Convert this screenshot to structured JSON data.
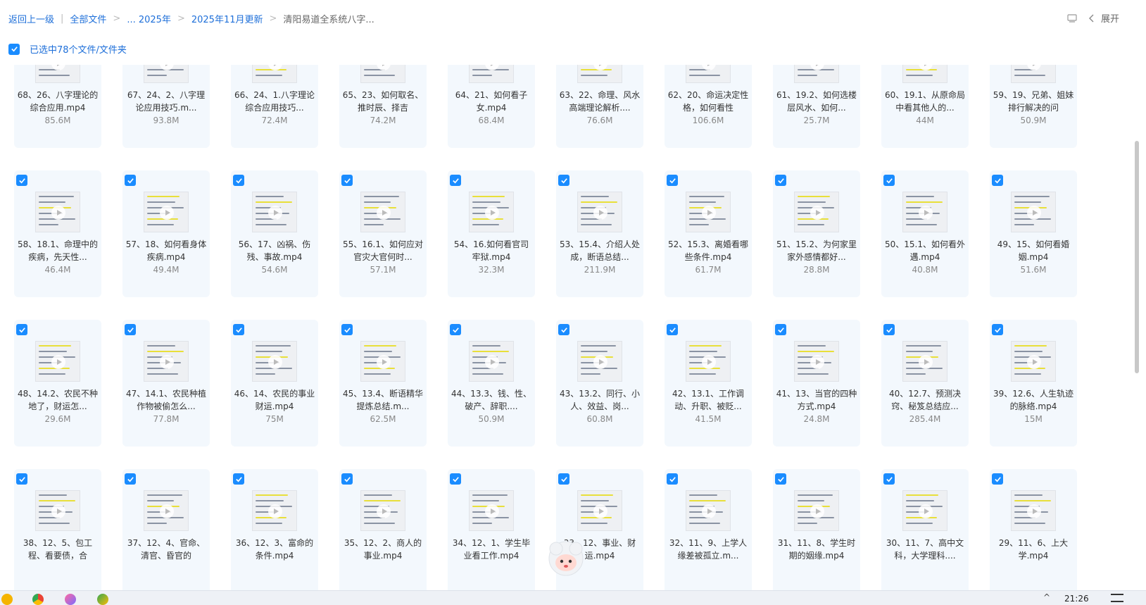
{
  "breadcrumb": {
    "back": "返回上一级",
    "items": [
      "全部文件",
      "... 2025年",
      "2025年11月更新",
      "清阳易道全系统八字..."
    ]
  },
  "toolbar": {
    "expand": "展开"
  },
  "selection": {
    "text": "已选中78个文件/文件夹"
  },
  "files": [
    {
      "name": "68、26、八字理论的综合应用.mp4",
      "size": "85.6M"
    },
    {
      "name": "67、24、2、八字理论应用技巧.m...",
      "size": "93.8M"
    },
    {
      "name": "66、24、1.八字理论综合应用技巧...",
      "size": "72.4M"
    },
    {
      "name": "65、23、如何取名、推时辰、择吉",
      "size": "74.2M"
    },
    {
      "name": "64、21、如何看子女.mp4",
      "size": "68.4M"
    },
    {
      "name": "63、22、命理、风水高端理论解析....",
      "size": "76.6M"
    },
    {
      "name": "62、20、命运决定性格，如何看性",
      "size": "106.6M"
    },
    {
      "name": "61、19.2、如何选楼层风水、如何...",
      "size": "25.7M"
    },
    {
      "name": "60、19.1、从原命局中看其他人的...",
      "size": "44M"
    },
    {
      "name": "59、19、兄弟、姐妹排行解决的问",
      "size": "50.9M"
    },
    {
      "name": "58、18.1、命理中的疾病，先天性...",
      "size": "46.4M"
    },
    {
      "name": "57、18、如何看身体疾病.mp4",
      "size": "49.4M"
    },
    {
      "name": "56、17、凶祸、伤残、事故.mp4",
      "size": "54.6M"
    },
    {
      "name": "55、16.1、如何应对官灾大官何时...",
      "size": "57.1M"
    },
    {
      "name": "54、16.如何看官司牢狱.mp4",
      "size": "32.3M"
    },
    {
      "name": "53、15.4、介绍人处成，断语总结...",
      "size": "211.9M"
    },
    {
      "name": "52、15.3、离婚看哪些条件.mp4",
      "size": "61.7M"
    },
    {
      "name": "51、15.2、为何家里家外感情都好...",
      "size": "28.8M"
    },
    {
      "name": "50、15.1、如何看外遇.mp4",
      "size": "40.8M"
    },
    {
      "name": "49、15、如何看婚姻.mp4",
      "size": "51.6M"
    },
    {
      "name": "48、14.2、农民不种地了，财运怎...",
      "size": "29.6M"
    },
    {
      "name": "47、14.1、农民种植作物被偷怎么...",
      "size": "77.8M"
    },
    {
      "name": "46、14、农民的事业财运.mp4",
      "size": "75M"
    },
    {
      "name": "45、13.4、断语精华提炼总结.m...",
      "size": "62.5M"
    },
    {
      "name": "44、13.3、钱、性、破产、辞职....",
      "size": "50.9M"
    },
    {
      "name": "43、13.2、同行、小人、效益、岗...",
      "size": "60.8M"
    },
    {
      "name": "42、13.1、工作调动、升职、被贬...",
      "size": "41.5M"
    },
    {
      "name": "41、13、当官的四种方式.mp4",
      "size": "24.8M"
    },
    {
      "name": "40、12.7、预测决窍、秘笈总结应...",
      "size": "285.4M"
    },
    {
      "name": "39、12.6、人生轨迹的脉络.mp4",
      "size": "15M"
    },
    {
      "name": "38、12、5、包工程、看要债，合",
      "size": ""
    },
    {
      "name": "37、12、4、官命、清官、昏官的",
      "size": ""
    },
    {
      "name": "36、12、3、富命的条件.mp4",
      "size": ""
    },
    {
      "name": "35、12、2、商人的事业.mp4",
      "size": ""
    },
    {
      "name": "34、12、1、学生毕业看工作.mp4",
      "size": ""
    },
    {
      "name": "33、12、事业、财运.mp4",
      "size": ""
    },
    {
      "name": "32、11、9、上学人缘差被孤立.m...",
      "size": ""
    },
    {
      "name": "31、11、8、学生时期的姻缘.mp4",
      "size": ""
    },
    {
      "name": "30、11、7、高中文科，大学理科....",
      "size": ""
    },
    {
      "name": "29、11、6、上大学.mp4",
      "size": ""
    }
  ],
  "taskbar": {
    "time": "21:26"
  },
  "colors": {
    "accent": "#1a8cff",
    "link": "#1e6fd9",
    "card_bg": "#f3f8fd"
  }
}
